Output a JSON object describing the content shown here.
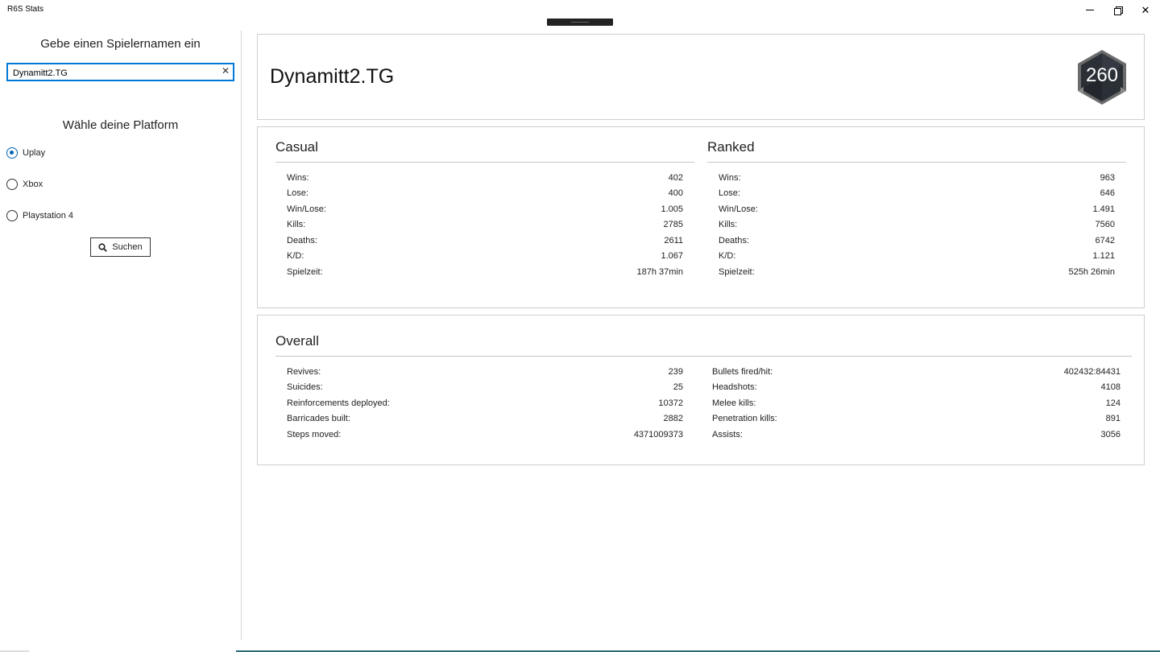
{
  "window": {
    "title": "R6S Stats",
    "minimize_icon": "minimize-icon",
    "maximize_icon": "restore-icon",
    "close_icon": "close-icon",
    "close_glyph": "✕"
  },
  "sidebar": {
    "search_heading": "Gebe einen Spielernamen ein",
    "search_value": "Dynamitt2.TG",
    "clear_glyph": "✕",
    "platform_heading": "Wähle deine Platform",
    "platforms": [
      {
        "label": "Uplay",
        "checked": true
      },
      {
        "label": "Xbox",
        "checked": false
      },
      {
        "label": "Playstation 4",
        "checked": false
      }
    ],
    "search_button": "Suchen"
  },
  "header": {
    "player_name": "Dynamitt2.TG",
    "level": "260"
  },
  "casual": {
    "title": "Casual",
    "rows": [
      {
        "label": "Wins:",
        "value": "402"
      },
      {
        "label": "Lose:",
        "value": "400"
      },
      {
        "label": "Win/Lose:",
        "value": "1.005"
      },
      {
        "label": "Kills:",
        "value": "2785"
      },
      {
        "label": "Deaths:",
        "value": "2611"
      },
      {
        "label": "K/D:",
        "value": "1.067"
      },
      {
        "label": "Spielzeit:",
        "value": "187h 37min"
      }
    ]
  },
  "ranked": {
    "title": "Ranked",
    "rows": [
      {
        "label": "Wins:",
        "value": "963"
      },
      {
        "label": "Lose:",
        "value": "646"
      },
      {
        "label": "Win/Lose:",
        "value": "1.491"
      },
      {
        "label": "Kills:",
        "value": "7560"
      },
      {
        "label": "Deaths:",
        "value": "6742"
      },
      {
        "label": "K/D:",
        "value": "1.121"
      },
      {
        "label": "Spielzeit:",
        "value": "525h 26min"
      }
    ]
  },
  "overall": {
    "title": "Overall",
    "left_rows": [
      {
        "label": "Revives:",
        "value": "239"
      },
      {
        "label": "Suicides:",
        "value": "25"
      },
      {
        "label": "Reinforcements deployed:",
        "value": "10372"
      },
      {
        "label": "Barricades built:",
        "value": "2882"
      },
      {
        "label": "Steps moved:",
        "value": "4371009373"
      }
    ],
    "right_rows": [
      {
        "label": "Bullets fired/hit:",
        "value": "402432:84431"
      },
      {
        "label": "Headshots:",
        "value": "4108"
      },
      {
        "label": "Melee kills:",
        "value": "124"
      },
      {
        "label": "Penetration kills:",
        "value": "891"
      },
      {
        "label": "Assists:",
        "value": "3056"
      }
    ]
  }
}
